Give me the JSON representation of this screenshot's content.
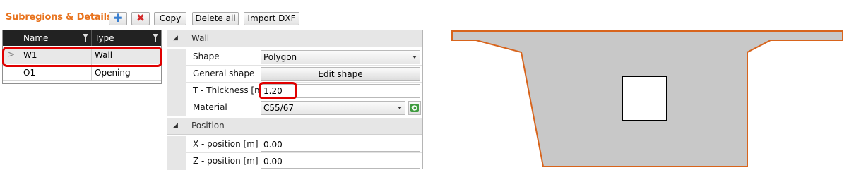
{
  "panel": {
    "title": "Subregions & Details",
    "toolbar": {
      "copy": "Copy",
      "delete_all": "Delete all",
      "import_dxf": "Import DXF"
    }
  },
  "grid": {
    "columns": [
      "Name",
      "Type"
    ],
    "rows": [
      {
        "marker": ">",
        "name": "W1",
        "type": "Wall",
        "selected": true
      },
      {
        "marker": "",
        "name": "O1",
        "type": "Opening",
        "selected": false
      }
    ]
  },
  "properties": {
    "wall_category": "Wall",
    "shape_label": "Shape",
    "shape_value": "Polygon",
    "general_shape_label": "General shape",
    "general_shape_button": "Edit shape",
    "thickness_label": "T - Thickness [m]",
    "thickness_value": "1.20",
    "material_label": "Material",
    "material_value": "C55/67",
    "position_category": "Position",
    "x_label": "X - position [m]",
    "x_value": "0.00",
    "z_label": "Z - position [m]",
    "z_value": "0.00"
  },
  "colors": {
    "title": "#e8731e",
    "highlight": "#e00000",
    "section_fill": "#c8c8c8",
    "section_outline": "#d8641c"
  },
  "icons": {
    "add": "plus-icon",
    "delete": "cross-icon",
    "refresh": "refresh-icon"
  }
}
